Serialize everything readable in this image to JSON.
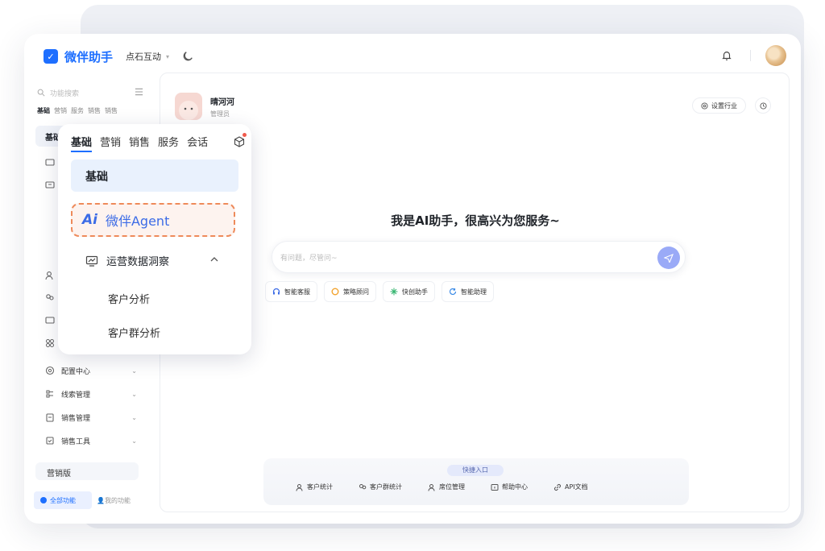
{
  "topbar": {
    "brand": "微伴助手",
    "org": "点石互动"
  },
  "sidebar": {
    "search_placeholder": "功能搜索",
    "tabs": [
      "基础",
      "营销",
      "服务",
      "销售",
      "销售"
    ],
    "active_section": "基础",
    "items": [
      {
        "label": "配置中心"
      },
      {
        "label": "线索管理"
      },
      {
        "label": "销售管理"
      },
      {
        "label": "销售工具"
      }
    ],
    "version_label": "营销版",
    "footer": {
      "all": "全部功能",
      "mine": "我的功能"
    }
  },
  "user": {
    "name": "晴河河",
    "role": "管理员"
  },
  "header_actions": {
    "set_industry": "设置行业"
  },
  "greeting": "我是AI助手，很高兴为您服务~",
  "ask": {
    "placeholder": "有问题，尽管问~"
  },
  "chips": [
    {
      "label": "智能客服",
      "color": "#3b6be6"
    },
    {
      "label": "策略顾问",
      "color": "#f2a22c"
    },
    {
      "label": "快创助手",
      "color": "#2fb36b"
    },
    {
      "label": "智能助理",
      "color": "#3b8be6"
    }
  ],
  "quick": {
    "label": "快捷入口",
    "items": [
      "客户统计",
      "客户群统计",
      "席位管理",
      "帮助中心",
      "API文档"
    ]
  },
  "popup": {
    "tabs": [
      "基础",
      "营销",
      "销售",
      "服务",
      "会话"
    ],
    "section": "基础",
    "agent_prefix": "Ai",
    "agent_label": "微伴Agent",
    "insight": "运营数据洞察",
    "subitems": [
      "客户分析",
      "客户群分析"
    ]
  },
  "colors": {
    "brand": "#1e6fff",
    "highlight_border": "#ee8a5a"
  }
}
